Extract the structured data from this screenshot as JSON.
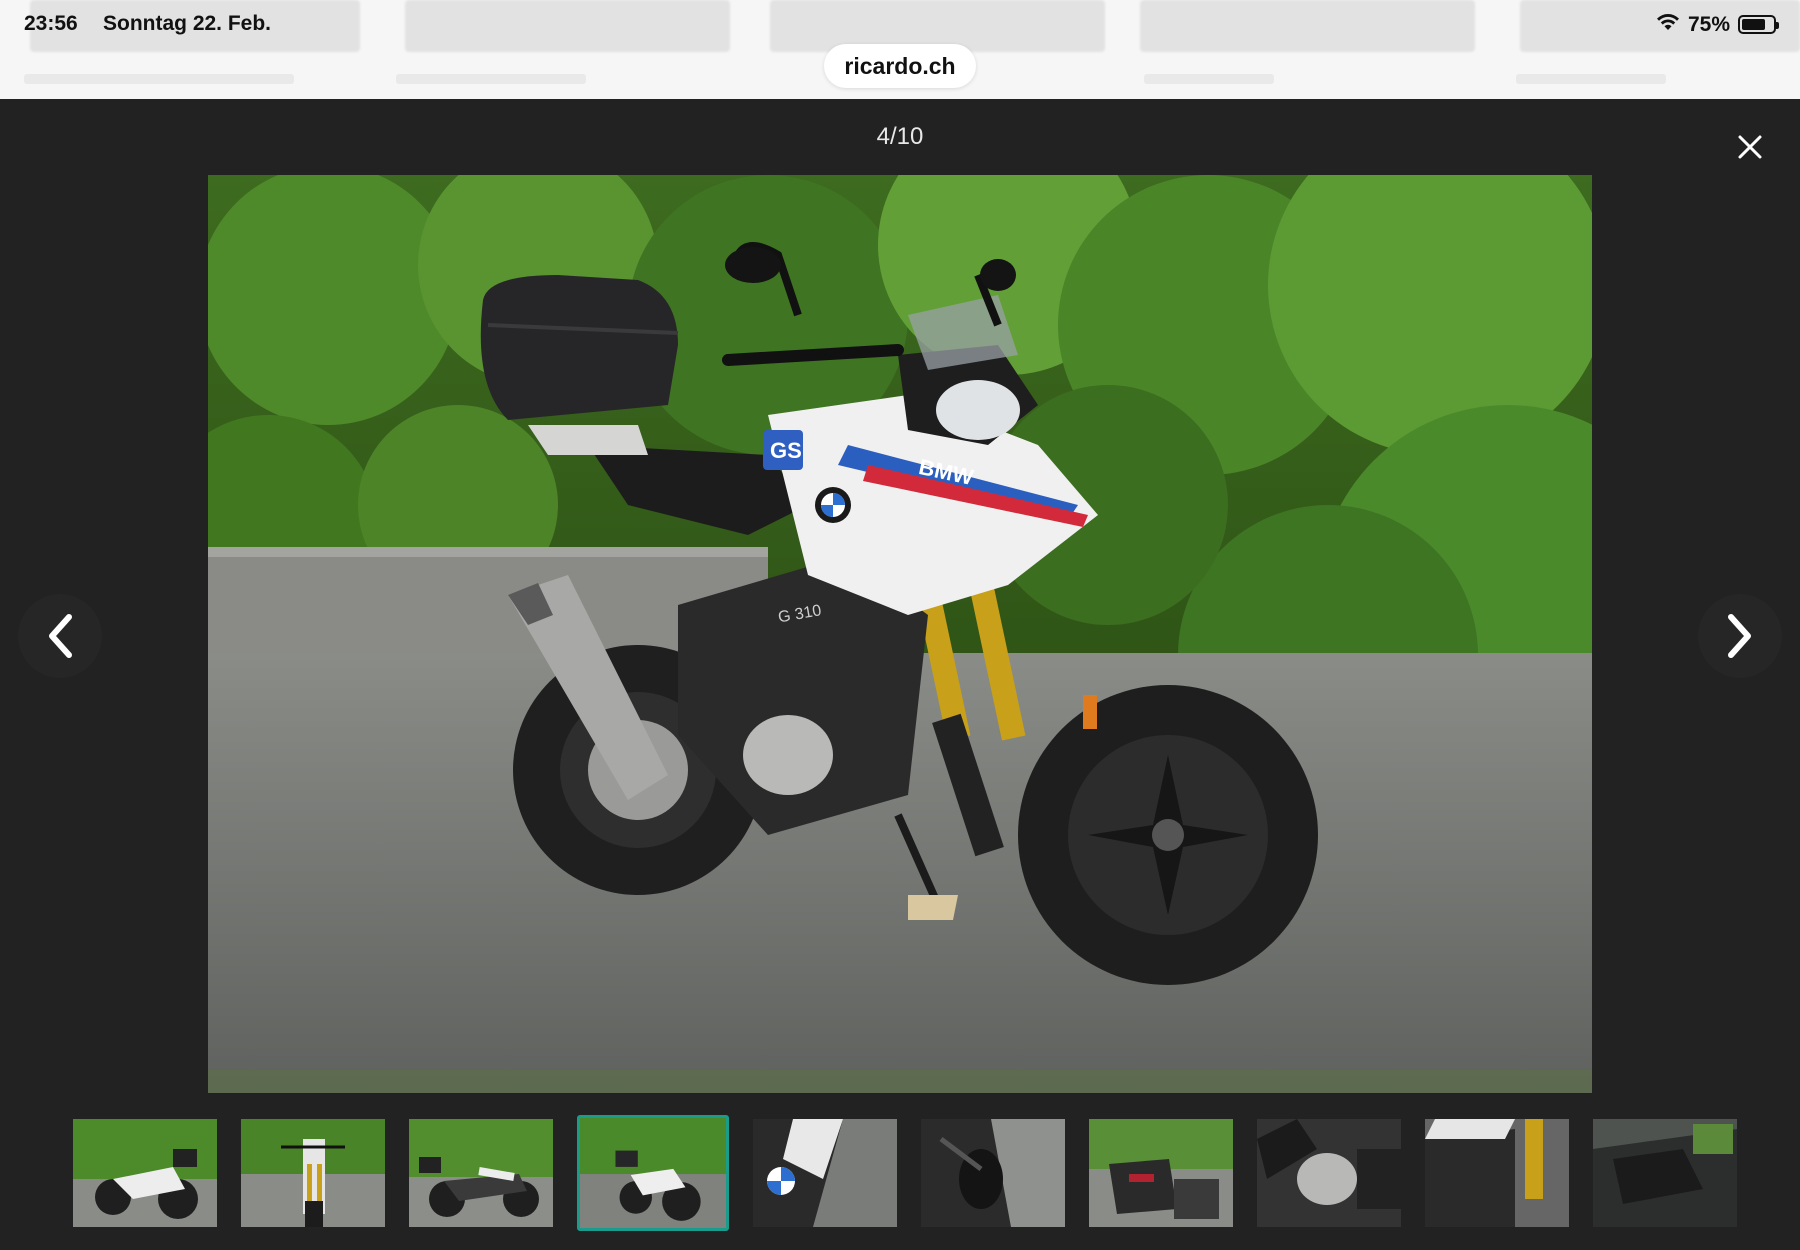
{
  "status_bar": {
    "time": "23:56",
    "date": "Sonntag 22. Feb.",
    "battery_percent": "75%",
    "battery_level": 0.75,
    "wifi_icon": "wifi-icon",
    "battery_icon": "battery-icon"
  },
  "browser": {
    "url": "ricardo.ch"
  },
  "gallery": {
    "counter": "4/10",
    "current_index": 4,
    "total": 10,
    "close_icon": "close-icon",
    "prev_icon": "chevron-left-icon",
    "next_icon": "chevron-right-icon",
    "motorcycle_brand": "BMW",
    "model_badge": "GS",
    "model_text": "G 310",
    "accent_color": "#1a9c8c"
  }
}
